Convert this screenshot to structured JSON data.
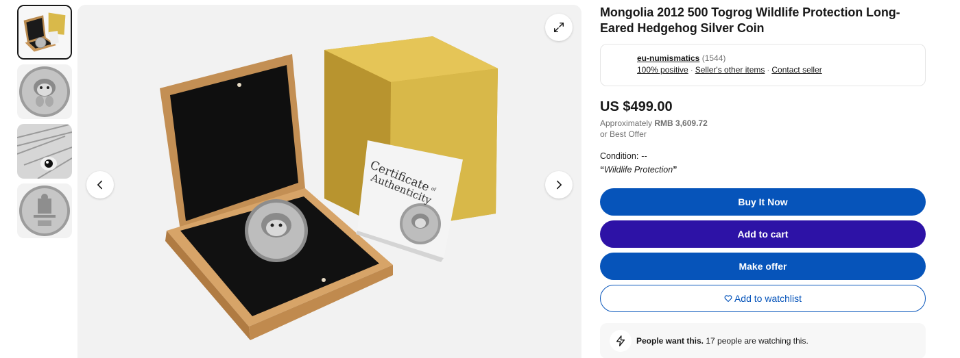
{
  "product": {
    "title": "Mongolia 2012 500 Togrog Wildlife Protection Long-Eared Hedgehog Silver Coin"
  },
  "seller": {
    "name": "eu-numismatics",
    "feedback_count": "(1544)",
    "positive": "100% positive",
    "separator": "·",
    "other_items": "Seller's other items",
    "contact": "Contact seller"
  },
  "pricing": {
    "price": "US $499.00",
    "approx_prefix": "Approximately",
    "approx_value": "RMB 3,609.72",
    "best_offer": "or Best Offer"
  },
  "condition": {
    "label": "Condition:",
    "value": "--",
    "quote_open": "“",
    "quote_text": "Wildlife Protection",
    "quote_close": "”"
  },
  "actions": {
    "buy_now": "Buy It Now",
    "add_to_cart": "Add to cart",
    "make_offer": "Make offer",
    "watchlist": "Add to watchlist"
  },
  "signal": {
    "bold": "People want this.",
    "text": "17 people are watching this."
  },
  "gallery": {
    "certificate_line1": "Certificate",
    "certificate_of": "of",
    "certificate_line2": "Authenticity",
    "thumbnails": [
      "box-with-coin",
      "hedgehog-obverse",
      "hedgehog-closeup",
      "coin-reverse"
    ],
    "selected_index": 0
  },
  "icons": {
    "expand": "expand-icon",
    "prev": "chevron-left-icon",
    "next": "chevron-right-icon",
    "heart": "heart-icon",
    "bolt": "lightning-icon"
  },
  "colors": {
    "primary_blue": "#0654ba",
    "cart_purple": "#2d12a6",
    "text": "#191919",
    "muted": "#707070"
  }
}
